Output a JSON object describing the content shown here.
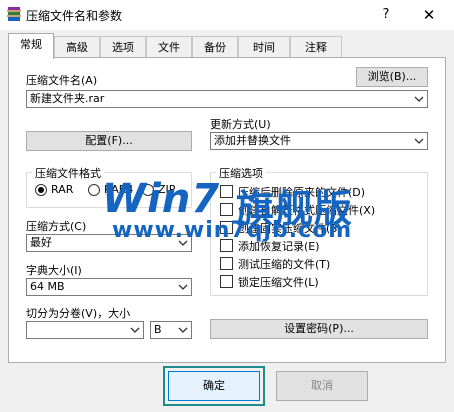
{
  "window": {
    "title": "压缩文件名和参数",
    "help": "?",
    "close": "✕"
  },
  "tabs": [
    "常规",
    "高级",
    "选项",
    "文件",
    "备份",
    "时间",
    "注释"
  ],
  "general": {
    "archive_name_label": "压缩文件名(A)",
    "archive_name_value": "新建文件夹.rar",
    "browse_label": "浏览(B)...",
    "profiles_label": "配置(F)...",
    "update_mode_label": "更新方式(U)",
    "update_mode_value": "添加并替换文件",
    "format_group_label": "压缩文件格式",
    "formats": [
      "RAR",
      "RAR4",
      "ZIP"
    ],
    "selected_format": "RAR",
    "method_label": "压缩方式(C)",
    "method_value": "最好",
    "dict_label": "字典大小(I)",
    "dict_value": "64 MB",
    "split_label": "切分为分卷(V)，大小",
    "split_value": "",
    "split_unit": "B",
    "options_group_label": "压缩选项",
    "options": [
      {
        "label": "压缩后删除原来的文件(D)",
        "checked": false
      },
      {
        "label": "创建自解压格式压缩文件(X)",
        "checked": false
      },
      {
        "label": "创建固实压缩文件(S)",
        "checked": false
      },
      {
        "label": "添加恢复记录(E)",
        "checked": false
      },
      {
        "label": "测试压缩的文件(T)",
        "checked": false
      },
      {
        "label": "锁定压缩文件(L)",
        "checked": false
      }
    ],
    "password_label": "设置密码(P)..."
  },
  "footer": {
    "ok_label": "确定",
    "cancel_label": "取消"
  },
  "watermark": {
    "brand": "Win7",
    "brand_cn": "旗舰版",
    "url": "www.win7qjb.com"
  },
  "colors": {
    "accent": "#0078d7",
    "highlight": "#1f8b8b",
    "watermark": "#1565c0"
  }
}
